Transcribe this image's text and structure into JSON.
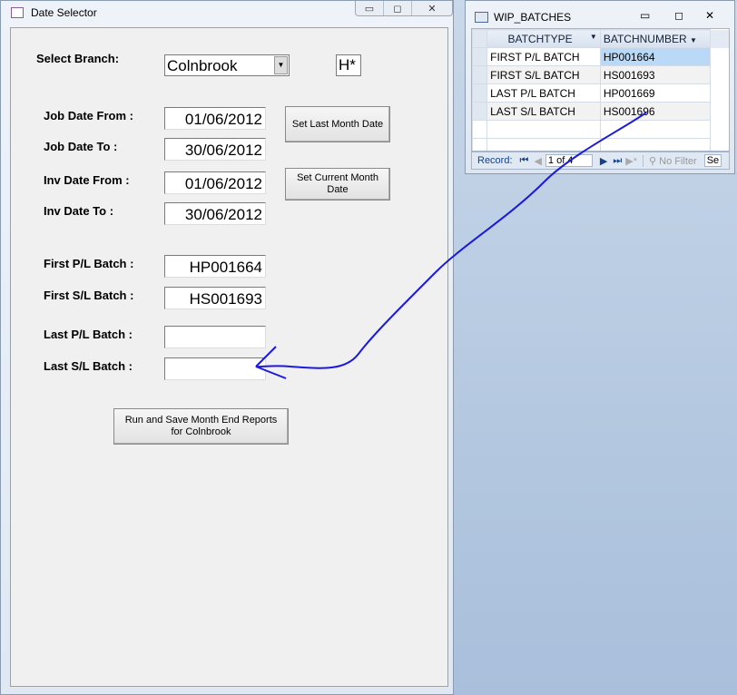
{
  "date_selector": {
    "title": "Date Selector",
    "select_branch_label": "Select Branch:",
    "branch_value": "Colnbrook",
    "branch_code": "H*",
    "job_date_from_label": "Job Date From :",
    "job_date_from": "01/06/2012",
    "job_date_to_label": "Job Date To :",
    "job_date_to": "30/06/2012",
    "inv_date_from_label": "Inv Date From :",
    "inv_date_from": "01/06/2012",
    "inv_date_to_label": "Inv Date To :",
    "inv_date_to": "30/06/2012",
    "set_last_month_button": "Set Last Month Date",
    "set_current_month_button": "Set Current Month Date",
    "first_pl_label": "First P/L Batch :",
    "first_pl": "HP001664",
    "first_sl_label": "First S/L Batch :",
    "first_sl": "HS001693",
    "last_pl_label": "Last P/L Batch :",
    "last_pl": "",
    "last_sl_label": "Last S/L Batch :",
    "last_sl": "",
    "run_button": "Run and Save Month End Reports for Colnbrook"
  },
  "wip_batches": {
    "title": "WIP_BATCHES",
    "columns": [
      "BATCHTYPE",
      "BATCHNUMBER"
    ],
    "rows": [
      [
        "FIRST P/L BATCH",
        "HP001664"
      ],
      [
        "FIRST S/L BATCH",
        "HS001693"
      ],
      [
        "LAST P/L BATCH",
        "HP001669"
      ],
      [
        "LAST S/L BATCH",
        "HS001696"
      ]
    ],
    "nav": {
      "record_label": "Record:",
      "position": "1 of 4",
      "filter": "No Filter",
      "search": "Se"
    }
  },
  "colors": {
    "ink": "#1a1adf",
    "selected_cell": "#b9d9f6"
  }
}
